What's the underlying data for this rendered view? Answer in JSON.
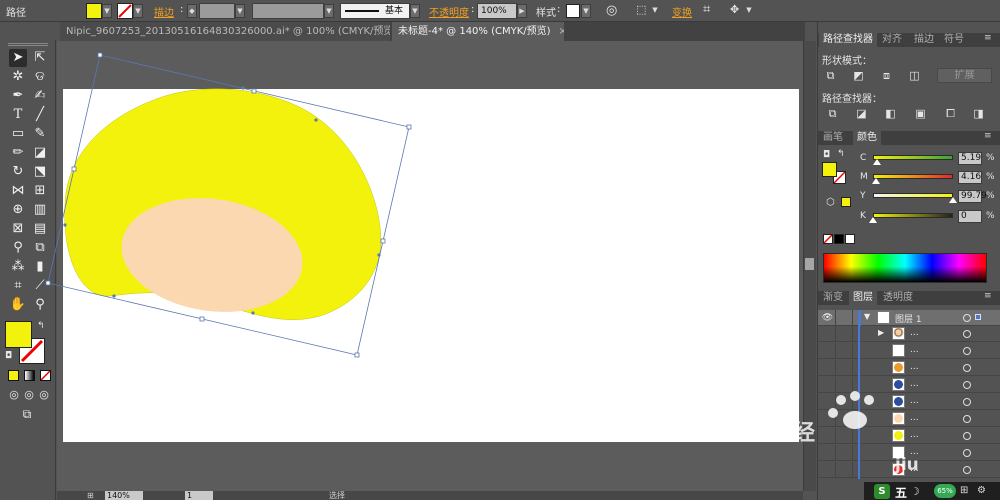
{
  "control_bar": {
    "path_label": "路径",
    "stroke_label": "描边",
    "stroke_profile": "基本",
    "opacity_label": "不透明度",
    "opacity_value": "100%",
    "style_label": "样式",
    "transform_label": "变换",
    "fill_color": "#f2f20c"
  },
  "doc_tabs": [
    {
      "title": "Nipic_9607253_20130516164830326000.ai* @ 100% (CMYK/预览)",
      "close": "×"
    },
    {
      "title": "未标题-4* @ 140% (CMYK/预览)",
      "close": "×"
    }
  ],
  "pathfinder_panel": {
    "tabs": [
      "路径查找器",
      "对齐",
      "描边",
      "符号"
    ],
    "shape_modes_label": "形状模式：",
    "expand_label": "扩展",
    "pathfinders_label": "路径查找器："
  },
  "color_panel": {
    "tabs": [
      "画笔",
      "颜色"
    ],
    "channels": [
      {
        "label": "C",
        "value": "5.19",
        "unit": "%",
        "level": 0.05
      },
      {
        "label": "M",
        "value": "4.16",
        "unit": "%",
        "level": 0.04
      },
      {
        "label": "Y",
        "value": "99.79",
        "unit": "%",
        "level": 0.998
      },
      {
        "label": "K",
        "value": "0",
        "unit": "%",
        "level": 0
      }
    ],
    "fill_color": "#f2f20c"
  },
  "layers_panel": {
    "tabs": [
      "渐变",
      "图层",
      "透明度"
    ],
    "layer_name": "图层 1",
    "sublayers": [
      {
        "label": "..."
      },
      {
        "label": "..."
      },
      {
        "label": "..."
      },
      {
        "label": "..."
      },
      {
        "label": "..."
      },
      {
        "label": "..."
      },
      {
        "label": "..."
      },
      {
        "label": "..."
      },
      {
        "label": "..."
      }
    ]
  },
  "status_bar": {
    "zoom": "140%",
    "page": "1",
    "selection": "选择"
  },
  "taskbar": {
    "ime_label": "五",
    "percent_badge": "65%"
  },
  "watermark": {
    "text": "jiu"
  },
  "colors": {
    "shape_yellow": "#f2f20c",
    "ellipse_peach": "#fbd8b0",
    "selection_blue": "#5a78b0",
    "layer_blue": "#4a78d8"
  }
}
